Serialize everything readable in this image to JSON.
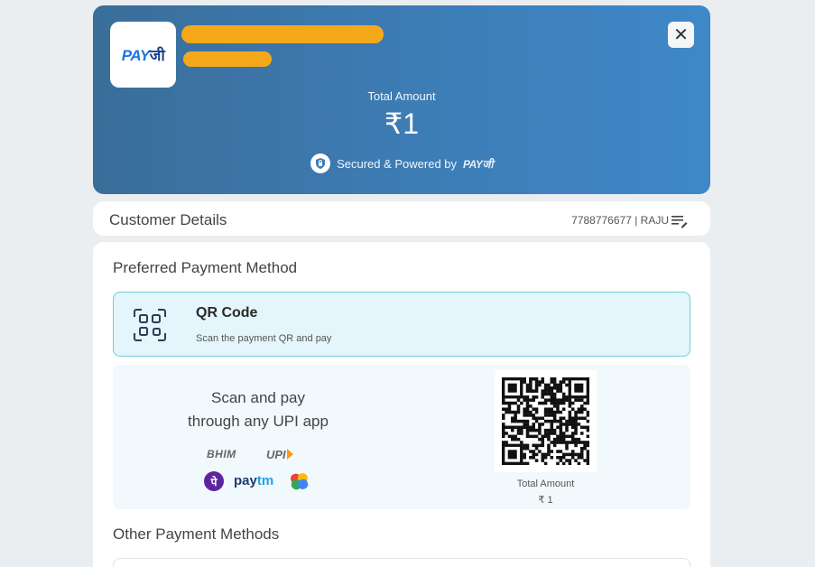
{
  "header": {
    "logo": {
      "pay": "PAY",
      "ji": "जी"
    },
    "total_label": "Total Amount",
    "total_value": "₹1",
    "secured_text": "Secured & Powered by",
    "powered_logo": "PAYजी",
    "close_icon": "close-icon"
  },
  "customer": {
    "title": "Customer Details",
    "info": "7788776677 | RAJU",
    "edit_icon": "edit-list-icon"
  },
  "payment": {
    "preferred_title": "Preferred Payment Method",
    "qr_option": {
      "title": "QR Code",
      "subtitle": "Scan the payment QR and pay",
      "icon": "qr-scan-icon"
    },
    "scan_line1": "Scan and pay",
    "scan_line2": "through any UPI app",
    "apps": {
      "bhim": "BHIM",
      "upi": "UPI",
      "phonepe": "पे",
      "paytm_a": "pay",
      "paytm_b": "tm",
      "gpay": "gpay-icon"
    },
    "qr_total_label": "Total Amount",
    "qr_total_value": "₹ 1",
    "other_title": "Other Payment Methods"
  },
  "colors": {
    "header_gradient_start": "#3a6e99",
    "header_gradient_end": "#3e88c9",
    "redaction": "#f6a81b",
    "qr_option_bg": "#e4f6fb",
    "qr_option_border": "#6dcfdc",
    "phonepe": "#5f259f"
  }
}
